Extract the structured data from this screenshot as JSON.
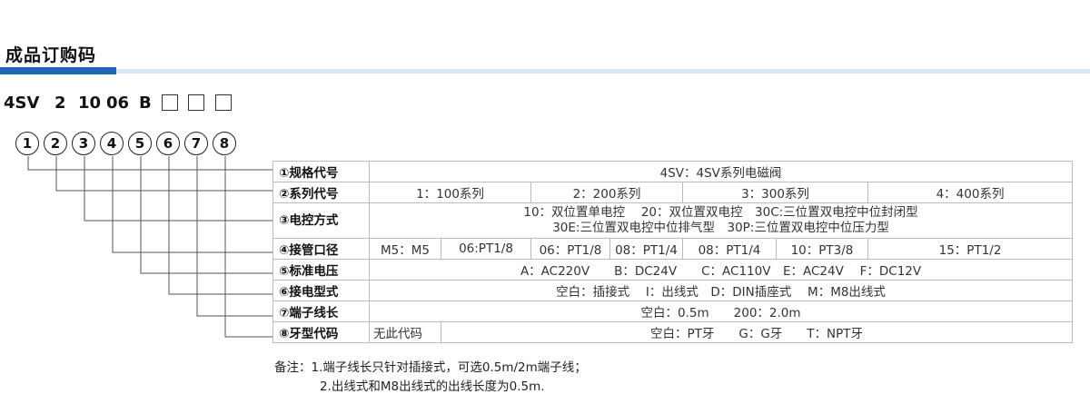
{
  "title": "成品订购码",
  "code": {
    "tokens": [
      "4SV",
      "2",
      "10",
      "06",
      "B"
    ],
    "boxes": 3
  },
  "circles": [
    "1",
    "2",
    "3",
    "4",
    "5",
    "6",
    "7",
    "8"
  ],
  "rows": [
    {
      "label": "①规格代号",
      "cells": [
        "4SV：4SV系列电磁阀"
      ]
    },
    {
      "label": "②系列代号",
      "cells": [
        "1：100系列",
        "2：200系列",
        "3：300系列",
        "4：400系列"
      ]
    },
    {
      "label": "③电控方式",
      "lines": [
        "10：双位置单电控　 20：双位置双电控　30C:三位置双电控中位封闭型",
        "30E:三位置双电控中位排气型　30P:三位置双电控中位压力型"
      ]
    },
    {
      "label": "④接管口径",
      "cells": [
        "M5：M5",
        "06:PT1/8",
        "06：PT1/8",
        "08：PT1/4",
        "08：PT1/4",
        "10：PT3/8",
        "15：PT1/2"
      ]
    },
    {
      "label": "⑤标准电压",
      "cells": [
        "A：AC220V　　B：DC24V　　C：AC110V　E：AC24V　 F：DC12V"
      ]
    },
    {
      "label": "⑥接电型式",
      "cells": [
        "空白：插接式　 I：出线式　D：DIN插座式　 M：M8出线式"
      ]
    },
    {
      "label": "⑦端子线长",
      "cells": [
        "空白：0.5m　　200：2.0m"
      ]
    },
    {
      "label": "⑧牙型代码",
      "cells": [
        "无此代码",
        "空白：PT牙　　G：G牙　　T：NPT牙"
      ]
    }
  ],
  "notes": [
    "备注：1.端子线长只针对插接式，可选0.5m/2m端子线；",
    "2.出线式和M8出线式的出线长度为0.5m."
  ]
}
